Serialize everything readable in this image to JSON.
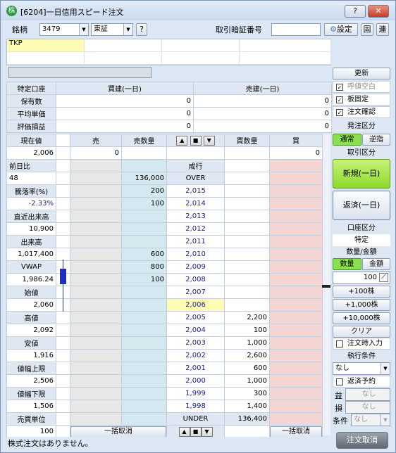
{
  "window": {
    "title": "[6204]一日信用スピード注文",
    "help_button": "?",
    "close_button": "✕"
  },
  "toolbar": {
    "symbol_label": "銘柄",
    "symbol_code": "3479",
    "exchange": "東証",
    "q_button": "?",
    "pin_label": "取引暗証番号",
    "pin_value": "",
    "settings_button": "設定",
    "fix_button": "固",
    "link_button": "連"
  },
  "stock_name": "TKP",
  "position": {
    "account": "特定口座",
    "buy_header": "買建(一日)",
    "sell_header": "売建(一日)",
    "rows": [
      {
        "label": "保有数",
        "buy": "0",
        "sell": "0"
      },
      {
        "label": "平均単価",
        "buy": "0",
        "sell": "0"
      },
      {
        "label": "評価損益",
        "buy": "0",
        "sell": "0"
      }
    ]
  },
  "board_header": {
    "sell": "売",
    "sell_qty": "売数量",
    "buy_qty": "買数量",
    "buy": "買",
    "sell_input": "0",
    "buy_input": "0"
  },
  "info": [
    {
      "label": "現在値",
      "value": "2,006"
    },
    {
      "label": "前日比",
      "value": "48"
    },
    {
      "label": "騰落率(%)",
      "value": "-2.33%"
    },
    {
      "label": "直近出来高",
      "value": "10,900"
    },
    {
      "label": "出来高",
      "value": "1,017,400"
    },
    {
      "label": "VWAP",
      "value": "1,986.24"
    },
    {
      "label": "始値",
      "value": "2,060"
    },
    {
      "label": "高値",
      "value": "2,092"
    },
    {
      "label": "安値",
      "value": "1,916"
    },
    {
      "label": "値幅上限",
      "value": "2,506"
    },
    {
      "label": "値幅下限",
      "value": "1,506"
    },
    {
      "label": "売買単位",
      "value": "100"
    }
  ],
  "ladder": [
    {
      "sell_qty": "",
      "price": "成行",
      "buy_qty": ""
    },
    {
      "sell_qty": "136,000",
      "price": "OVER",
      "buy_qty": ""
    },
    {
      "sell_qty": "200",
      "price": "2,015",
      "buy_qty": ""
    },
    {
      "sell_qty": "100",
      "price": "2,014",
      "buy_qty": ""
    },
    {
      "sell_qty": "",
      "price": "2,013",
      "buy_qty": ""
    },
    {
      "sell_qty": "",
      "price": "2,012",
      "buy_qty": ""
    },
    {
      "sell_qty": "",
      "price": "2,011",
      "buy_qty": ""
    },
    {
      "sell_qty": "600",
      "price": "2,010",
      "buy_qty": ""
    },
    {
      "sell_qty": "800",
      "price": "2,009",
      "buy_qty": ""
    },
    {
      "sell_qty": "100",
      "price": "2,008",
      "buy_qty": ""
    },
    {
      "sell_qty": "",
      "price": "2,007",
      "buy_qty": ""
    },
    {
      "sell_qty": "",
      "price": "2,006",
      "buy_qty": ""
    },
    {
      "sell_qty": "",
      "price": "2,005",
      "buy_qty": "2,200"
    },
    {
      "sell_qty": "",
      "price": "2,004",
      "buy_qty": "100"
    },
    {
      "sell_qty": "",
      "price": "2,003",
      "buy_qty": "1,000"
    },
    {
      "sell_qty": "",
      "price": "2,002",
      "buy_qty": "2,600"
    },
    {
      "sell_qty": "",
      "price": "2,001",
      "buy_qty": "600"
    },
    {
      "sell_qty": "",
      "price": "2,000",
      "buy_qty": "1,000"
    },
    {
      "sell_qty": "",
      "price": "1,999",
      "buy_qty": "300"
    },
    {
      "sell_qty": "",
      "price": "1,998",
      "buy_qty": "1,400"
    },
    {
      "sell_qty": "",
      "price": "UNDER",
      "buy_qty": "136,400"
    }
  ],
  "bottom": {
    "cancel_all_sell": "一括取消",
    "cancel_all_buy": "一括取消"
  },
  "side": {
    "update": "更新",
    "checks": [
      {
        "label": "呼値空白",
        "checked": true
      },
      {
        "label": "板固定",
        "checked": true
      },
      {
        "label": "注文確認",
        "checked": true
      }
    ],
    "order_type_header": "発注区分",
    "order_normal": "通常",
    "order_reverse": "逆指",
    "trade_type_header": "取引区分",
    "new_button": "新規(一日)",
    "repay_button": "返済(一日)",
    "account_header": "口座区分",
    "account_value": "特定",
    "qty_header": "数量/金額",
    "qty_tab": "数量",
    "amount_tab": "金額",
    "qty_value": "100",
    "plus100": "+100株",
    "plus1000": "+1,000株",
    "plus10000": "+10,000株",
    "clear": "クリア",
    "order_time_input": "注文時入力",
    "exec_header": "執行条件",
    "exec_value": "なし",
    "repay_reserve": "返済予約",
    "profit_label": "益",
    "profit_value": "なし",
    "loss_label": "損",
    "loss_value": "なし",
    "cond_label": "条件",
    "cond_value": "なし"
  },
  "status": "株式注文はありません。",
  "order_cancel": "注文取消"
}
